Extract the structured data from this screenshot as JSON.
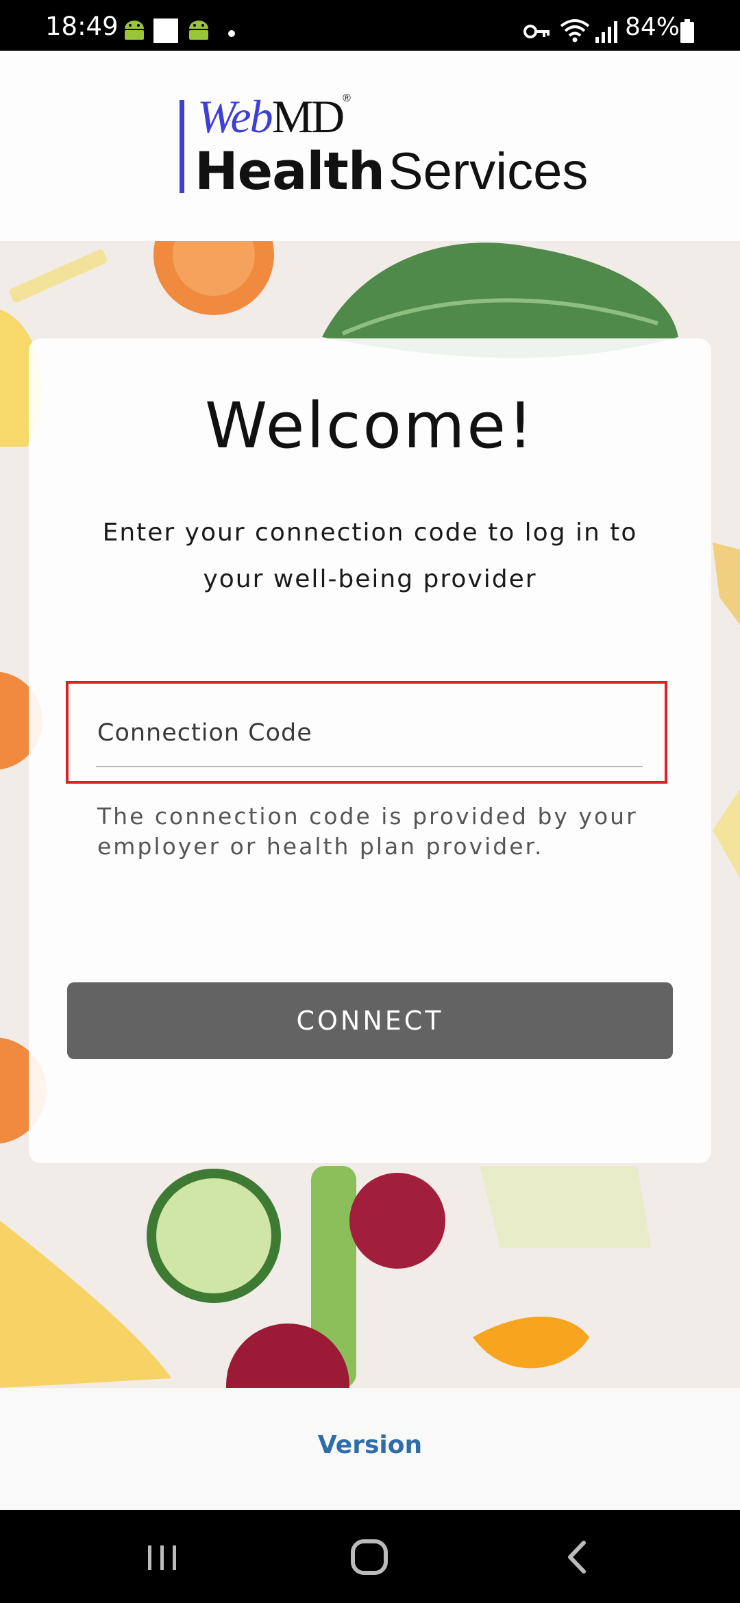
{
  "status_bar": {
    "time": "18:49",
    "battery": "84%",
    "icons": [
      "android-icon",
      "square-notification-icon",
      "android-icon",
      "dot-icon",
      "vpn-key-icon",
      "wifi-icon",
      "signal-icon",
      "battery-icon"
    ]
  },
  "header": {
    "logo_web": "Web",
    "logo_md": "MD",
    "logo_reg": "®",
    "logo_health": "Health",
    "logo_services": "Services"
  },
  "card": {
    "title": "Welcome!",
    "intro": "Enter your connection code to log in to your well-being provider",
    "input_placeholder": "Connection Code",
    "input_value": "",
    "helper": "The connection code is provided by your employer or health plan provider.",
    "connect_label": "CONNECT"
  },
  "footer": {
    "version_label": "Version"
  },
  "colors": {
    "brand_blue": "#3f3fd6",
    "highlight_red": "#e01e25",
    "button_gray": "#636363",
    "link_blue": "#2f6da8"
  },
  "nav_bar": {
    "icons": [
      "recent-apps-icon",
      "home-icon",
      "back-icon"
    ]
  }
}
